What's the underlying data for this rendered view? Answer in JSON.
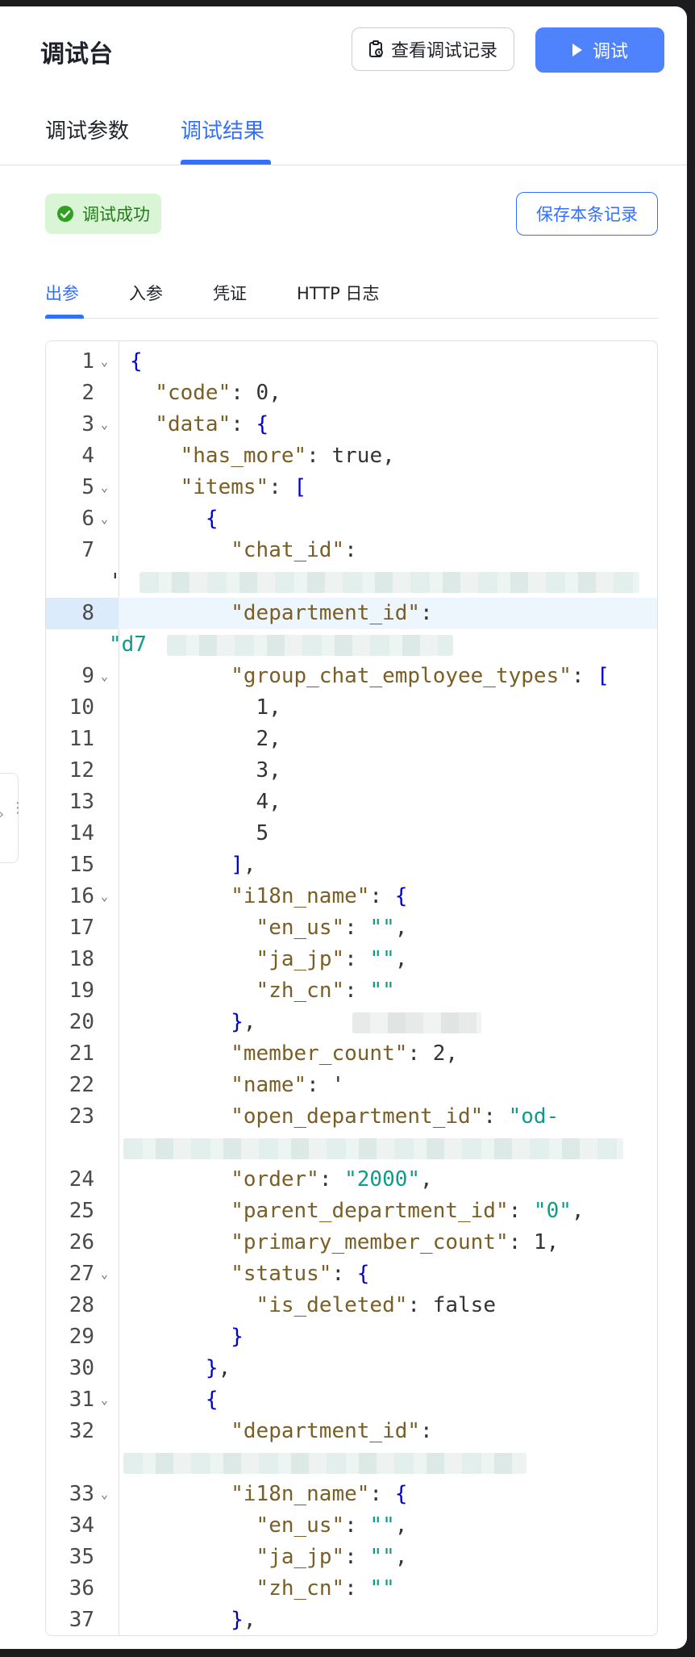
{
  "header": {
    "title": "调试台",
    "history_button": "查看调试记录",
    "run_button": "调试",
    "icons": {
      "history": "history-icon",
      "run": "play-icon"
    }
  },
  "main_tabs": [
    {
      "label": "调试参数",
      "active": false
    },
    {
      "label": "调试结果",
      "active": true
    }
  ],
  "result": {
    "status": "调试成功",
    "save_button": "保存本条记录",
    "colors": {
      "accent": "#3370ff",
      "success_bg": "#d9f5d6",
      "success_text": "#237b19"
    }
  },
  "result_tabs": [
    {
      "label": "出参",
      "active": true
    },
    {
      "label": "入参",
      "active": false
    },
    {
      "label": "凭证",
      "active": false
    },
    {
      "label": "HTTP 日志",
      "active": false
    }
  ],
  "code": {
    "lines": [
      {
        "n": "1",
        "text": "{",
        "fold": true
      },
      {
        "n": "2",
        "text": "  \"code\": 0,",
        "fold": false
      },
      {
        "n": "3",
        "text": "  \"data\": {",
        "fold": true
      },
      {
        "n": "4",
        "text": "    \"has_more\": true,",
        "fold": false
      },
      {
        "n": "5",
        "text": "    \"items\": [",
        "fold": true
      },
      {
        "n": "6",
        "text": "      {",
        "fold": true
      },
      {
        "n": "7",
        "text": "        \"chat_id\":",
        "fold": false
      },
      {
        "n": "",
        "text": "'",
        "fold": false
      },
      {
        "n": "8",
        "text": "        \"department_id\":",
        "fold": false
      },
      {
        "n": "",
        "text": "\"d7",
        "fold": false
      },
      {
        "n": "9",
        "text": "        \"group_chat_employee_types\": [",
        "fold": true
      },
      {
        "n": "10",
        "text": "          1,",
        "fold": false
      },
      {
        "n": "11",
        "text": "          2,",
        "fold": false
      },
      {
        "n": "12",
        "text": "          3,",
        "fold": false
      },
      {
        "n": "13",
        "text": "          4,",
        "fold": false
      },
      {
        "n": "14",
        "text": "          5",
        "fold": false
      },
      {
        "n": "15",
        "text": "        ],",
        "fold": false
      },
      {
        "n": "16",
        "text": "        \"i18n_name\": {",
        "fold": true
      },
      {
        "n": "17",
        "text": "          \"en_us\": \"\",",
        "fold": false
      },
      {
        "n": "18",
        "text": "          \"ja_jp\": \"\",",
        "fold": false
      },
      {
        "n": "19",
        "text": "          \"zh_cn\": \"\"",
        "fold": false
      },
      {
        "n": "20",
        "text": "        },",
        "fold": false
      },
      {
        "n": "21",
        "text": "        \"member_count\": 2,",
        "fold": false
      },
      {
        "n": "22",
        "text": "        \"name\": '",
        "fold": false
      },
      {
        "n": "23",
        "text": "        \"open_department_id\": \"od-",
        "fold": false
      },
      {
        "n": "",
        "text": "",
        "fold": false
      },
      {
        "n": "24",
        "text": "        \"order\": \"2000\",",
        "fold": false
      },
      {
        "n": "25",
        "text": "        \"parent_department_id\": \"0\",",
        "fold": false
      },
      {
        "n": "26",
        "text": "        \"primary_member_count\": 1,",
        "fold": false
      },
      {
        "n": "27",
        "text": "        \"status\": {",
        "fold": true
      },
      {
        "n": "28",
        "text": "          \"is_deleted\": false",
        "fold": false
      },
      {
        "n": "29",
        "text": "        }",
        "fold": false
      },
      {
        "n": "30",
        "text": "      },",
        "fold": false
      },
      {
        "n": "31",
        "text": "      {",
        "fold": true
      },
      {
        "n": "32",
        "text": "        \"department_id\":",
        "fold": false
      },
      {
        "n": "",
        "text": "",
        "fold": false
      },
      {
        "n": "33",
        "text": "        \"i18n_name\": {",
        "fold": true
      },
      {
        "n": "34",
        "text": "          \"en_us\": \"\",",
        "fold": false
      },
      {
        "n": "35",
        "text": "          \"ja_jp\": \"\",",
        "fold": false
      },
      {
        "n": "36",
        "text": "          \"zh_cn\": \"\"",
        "fold": false
      },
      {
        "n": "37",
        "text": "        },",
        "fold": false
      }
    ],
    "highlighted_line": "8"
  }
}
